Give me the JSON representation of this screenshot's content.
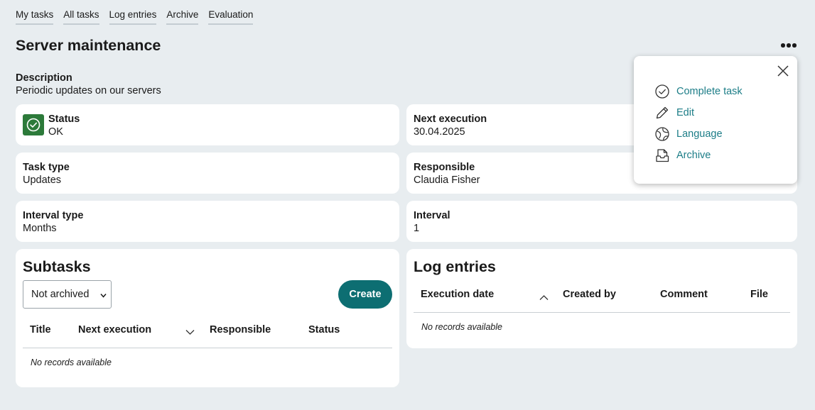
{
  "nav": {
    "tabs": [
      {
        "label": "My tasks"
      },
      {
        "label": "All tasks"
      },
      {
        "label": "Log entries"
      },
      {
        "label": "Archive"
      },
      {
        "label": "Evaluation"
      }
    ]
  },
  "page": {
    "title": "Server maintenance",
    "more_icon": "more-horizontal-icon"
  },
  "description": {
    "label": "Description",
    "value": "Periodic updates on our servers"
  },
  "fields": {
    "status": {
      "label": "Status",
      "value": "OK",
      "icon": "check-circle-icon",
      "color": "#2c7a3a"
    },
    "next_execution": {
      "label": "Next execution",
      "value": "30.04.2025"
    },
    "task_type": {
      "label": "Task type",
      "value": "Updates"
    },
    "responsible": {
      "label": "Responsible",
      "value": "Claudia Fisher"
    },
    "interval_type": {
      "label": "Interval type",
      "value": "Months"
    },
    "interval": {
      "label": "Interval",
      "value": "1"
    }
  },
  "subtasks": {
    "title": "Subtasks",
    "filter_selected": "Not archived",
    "create_label": "Create",
    "columns": [
      "Title",
      "Next execution",
      "Responsible",
      "Status"
    ],
    "empty_text": "No records available"
  },
  "log_entries": {
    "title": "Log entries",
    "columns": [
      "Execution date",
      "Created by",
      "Comment",
      "File"
    ],
    "empty_text": "No records available"
  },
  "menu": {
    "items": [
      {
        "label": "Complete task",
        "icon": "check-circle-icon"
      },
      {
        "label": "Edit",
        "icon": "pencil-icon"
      },
      {
        "label": "Language",
        "icon": "globe-icon"
      },
      {
        "label": "Archive",
        "icon": "archive-box-icon"
      }
    ]
  },
  "colors": {
    "accent": "#0d6e72",
    "link": "#1c7d87",
    "background": "#e8edf0",
    "status_ok": "#2c7a3a"
  }
}
